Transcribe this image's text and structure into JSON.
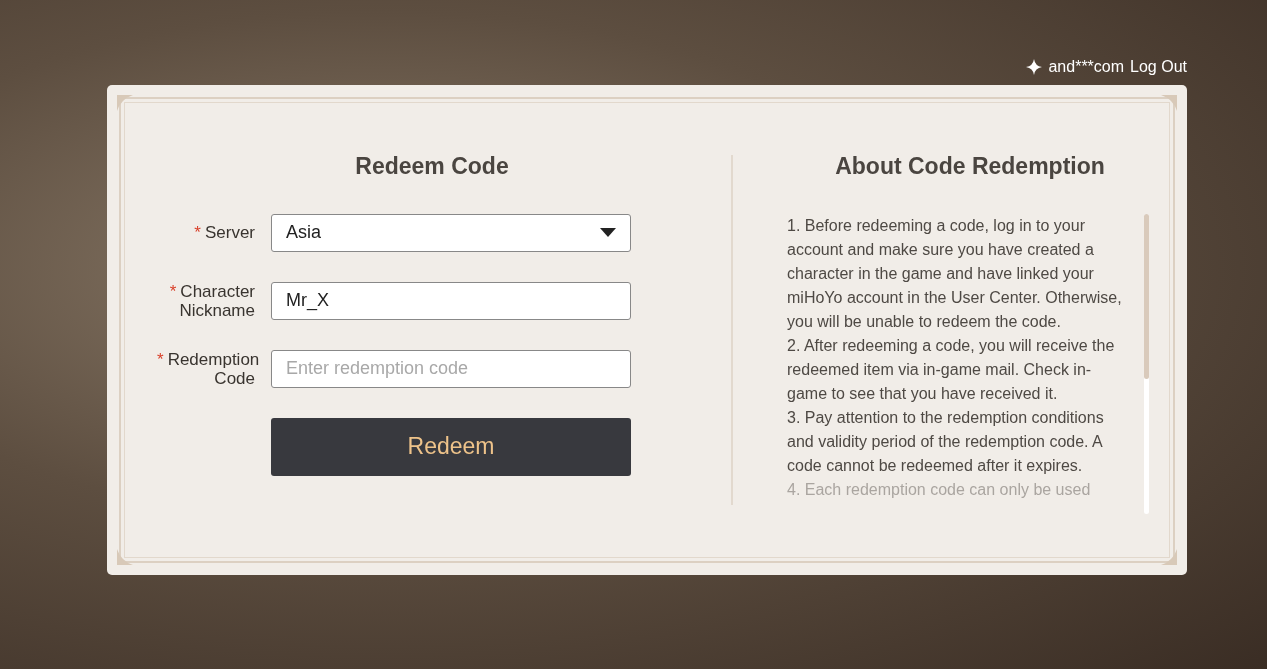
{
  "account": {
    "user": "and***com",
    "logout": "Log Out"
  },
  "form": {
    "title": "Redeem Code",
    "fields": [
      {
        "kind": "select",
        "label": "Server",
        "required_mark": "*",
        "value": "Asia"
      },
      {
        "kind": "text",
        "label": "Character Nickname",
        "required_mark": "*",
        "value": "Mr_X"
      },
      {
        "kind": "text",
        "label": "Redemption Code",
        "required_mark": "*",
        "placeholder": "Enter redemption code"
      }
    ],
    "submit": "Redeem"
  },
  "about": {
    "title": "About Code Redemption",
    "items": [
      "1. Before redeeming a code, log in to your account and make sure you have created a character in the game and have linked your miHoYo account in the User Center. Otherwise, you will be unable to redeem the code.",
      "2. After redeeming a code, you will receive the redeemed item via in-game mail. Check in-game to see that you have received it.",
      "3. Pay attention to the redemption conditions and validity period of the redemption code. A code cannot be redeemed after it expires.",
      "4. Each redemption code can only be used"
    ]
  }
}
